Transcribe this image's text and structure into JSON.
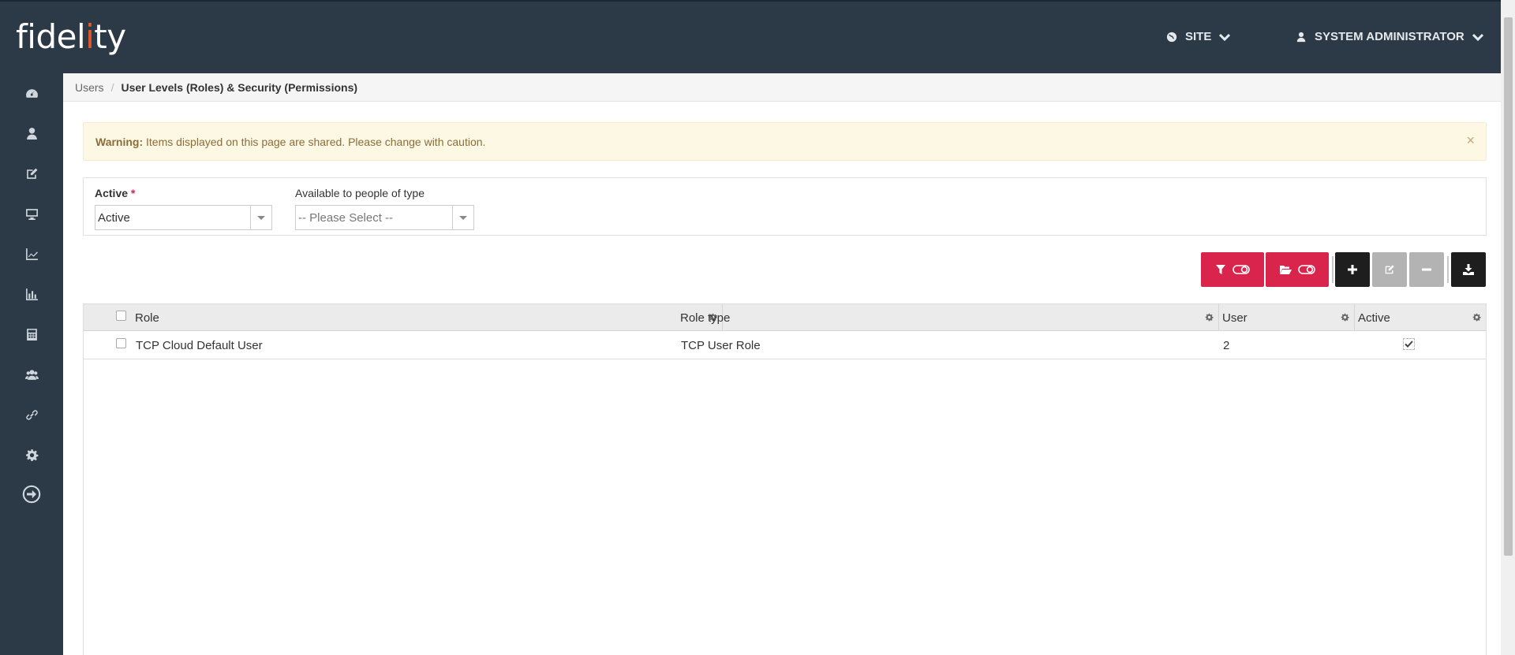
{
  "header": {
    "logo_prefix": "fidel",
    "logo_accent": "i",
    "logo_suffix": "ty",
    "logo_accent_color": "#e8542c",
    "site_label": "SITE",
    "user_label": "SYSTEM ADMINISTRATOR"
  },
  "sidebar": {
    "items": [
      {
        "icon": "dashboard-icon"
      },
      {
        "icon": "user-icon"
      },
      {
        "icon": "edit-icon"
      },
      {
        "icon": "monitor-icon"
      },
      {
        "icon": "line-chart-icon"
      },
      {
        "icon": "bar-chart-icon"
      },
      {
        "icon": "calculator-icon"
      },
      {
        "icon": "users-icon"
      },
      {
        "icon": "link-icon"
      },
      {
        "icon": "gear-icon"
      },
      {
        "icon": "logout-icon"
      }
    ]
  },
  "breadcrumb": {
    "parent": "Users",
    "separator": "/",
    "current": "User Levels (Roles) & Security (Permissions)"
  },
  "alert": {
    "title": "Warning:",
    "message": " Items displayed on this page are shared. Please change with caution.",
    "close": "×"
  },
  "filters": {
    "active_label": "Active",
    "active_required": "*",
    "active_value": "Active",
    "type_label": "Available to people of type",
    "type_placeholder": "-- Please Select --"
  },
  "toolbar": {
    "buttons": [
      "filter-toggle",
      "folder-toggle",
      "add",
      "edit",
      "remove",
      "download"
    ],
    "accent_color": "#d9254c"
  },
  "grid": {
    "columns": [
      "Role",
      "Role type",
      "User",
      "Active"
    ],
    "rows": [
      {
        "role": "TCP Cloud Default User",
        "role_type": "TCP User Role",
        "user": "2",
        "active": true
      }
    ]
  }
}
